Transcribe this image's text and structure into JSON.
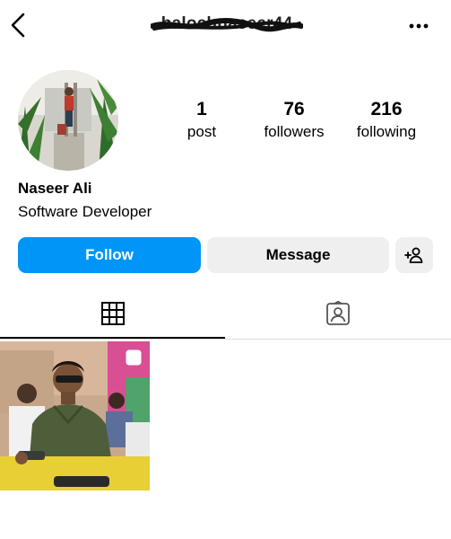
{
  "header": {
    "username": "balochnaseer44",
    "back_icon": "chevron-left-icon",
    "more_icon": "more-horizontal-icon"
  },
  "profile": {
    "display_name": "Naseer Ali",
    "bio": "Software Developer",
    "stats": {
      "posts_count": "1",
      "posts_label": "post",
      "followers_count": "76",
      "followers_label": "followers",
      "following_count": "216",
      "following_label": "following"
    }
  },
  "actions": {
    "follow_label": "Follow",
    "message_label": "Message",
    "add_user_icon": "add-user-icon"
  },
  "tabs": [
    {
      "icon": "grid-icon",
      "active": true
    },
    {
      "icon": "tagged-icon",
      "active": false
    }
  ],
  "colors": {
    "accent": "#0095f6",
    "secondary_button": "#efefef",
    "divider": "#dbdbdb"
  }
}
